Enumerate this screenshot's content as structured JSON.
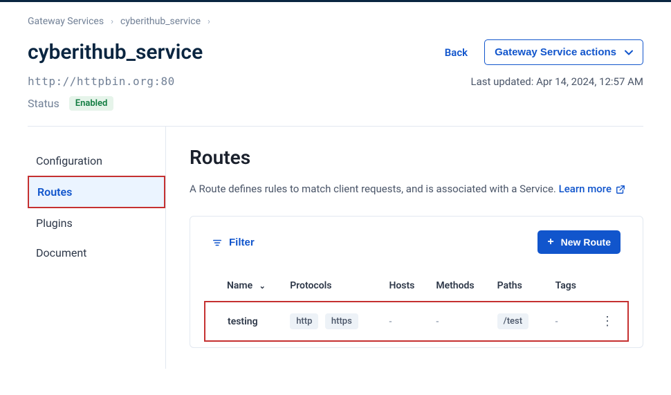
{
  "breadcrumb": {
    "root": "Gateway Services",
    "service": "cyberithub_service"
  },
  "header": {
    "title": "cyberithub_service",
    "back_label": "Back",
    "actions_label": "Gateway Service actions"
  },
  "meta": {
    "url": "http://httpbin.org:80",
    "last_updated": "Last updated: Apr 14, 2024, 12:57 AM",
    "status_label": "Status",
    "status_value": "Enabled"
  },
  "sidebar": {
    "items": [
      {
        "label": "Configuration"
      },
      {
        "label": "Routes"
      },
      {
        "label": "Plugins"
      },
      {
        "label": "Document"
      }
    ]
  },
  "routes": {
    "title": "Routes",
    "description": "A Route defines rules to match client requests, and is associated with a Service.",
    "learn_more": "Learn more",
    "filter_label": "Filter",
    "new_route_label": "New Route",
    "columns": {
      "name": "Name",
      "protocols": "Protocols",
      "hosts": "Hosts",
      "methods": "Methods",
      "paths": "Paths",
      "tags": "Tags"
    },
    "rows": [
      {
        "name": "testing",
        "protocol1": "http",
        "protocol2": "https",
        "hosts": "-",
        "methods": "-",
        "path": "/test",
        "tags": "-"
      }
    ]
  }
}
